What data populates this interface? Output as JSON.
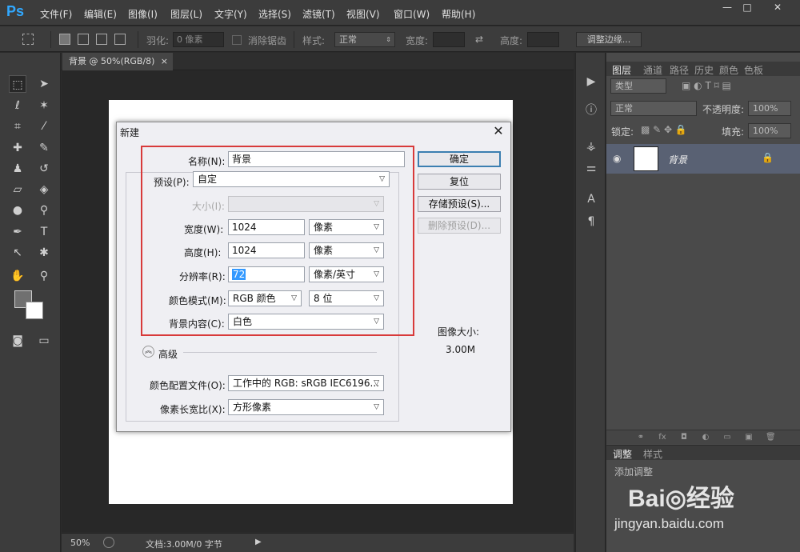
{
  "app": {
    "logo": "Ps",
    "menu": [
      "文件(F)",
      "编辑(E)",
      "图像(I)",
      "图层(L)",
      "文字(Y)",
      "选择(S)",
      "滤镜(T)",
      "视图(V)",
      "窗口(W)",
      "帮助(H)"
    ],
    "window_buttons": [
      "—",
      "□",
      "✕"
    ]
  },
  "options_bar": {
    "feather_label": "羽化:",
    "feather_value": "0 像素",
    "antialias_label": "消除锯齿",
    "style_label": "样式:",
    "style_value": "正常",
    "width_label": "宽度:",
    "height_label": "高度:",
    "refine_edge_button": "调整边缘..."
  },
  "document": {
    "tab_title": "背景 @ 50%(RGB/8)",
    "tab_close": "×",
    "zoom": "50%",
    "doc_info": "文档:3.00M/0 字节"
  },
  "layers_panel": {
    "tabs": [
      "图层",
      "通道",
      "路径",
      "历史",
      "颜色",
      "色板"
    ],
    "filter_kind": "类型",
    "blend_mode": "正常",
    "opacity_label": "不透明度:",
    "opacity_value": "100%",
    "lock_label": "锁定:",
    "fill_label": "填充:",
    "fill_value": "100%",
    "layer_name": "背景"
  },
  "adjustments_panel": {
    "tabs": [
      "调整",
      "样式"
    ],
    "add_label": "添加调整"
  },
  "dialog": {
    "title": "新建",
    "close": "✕",
    "name_label": "名称(N):",
    "name_value": "背景",
    "preset_label": "预设(P):",
    "preset_value": "自定",
    "size_label": "大小(I):",
    "width_label": "宽度(W):",
    "width_value": "1024",
    "width_unit": "像素",
    "height_label": "高度(H):",
    "height_value": "1024",
    "height_unit": "像素",
    "resolution_label": "分辨率(R):",
    "resolution_value": "72",
    "resolution_unit": "像素/英寸",
    "color_mode_label": "颜色模式(M):",
    "color_mode_value": "RGB 颜色",
    "bit_depth_value": "8 位",
    "background_label": "背景内容(C):",
    "background_value": "白色",
    "advanced_label": "高级",
    "color_profile_label": "颜色配置文件(O):",
    "color_profile_value": "工作中的 RGB: sRGB IEC6196...",
    "pixel_aspect_label": "像素长宽比(X):",
    "pixel_aspect_value": "方形像素",
    "ok_button": "确定",
    "reset_button": "复位",
    "save_preset_button": "存储预设(S)...",
    "delete_preset_button": "删除预设(D)...",
    "image_size_label": "图像大小:",
    "image_size_value": "3.00M"
  },
  "watermark": {
    "logo": "Bai◎经验",
    "url": "jingyan.baidu.com"
  }
}
